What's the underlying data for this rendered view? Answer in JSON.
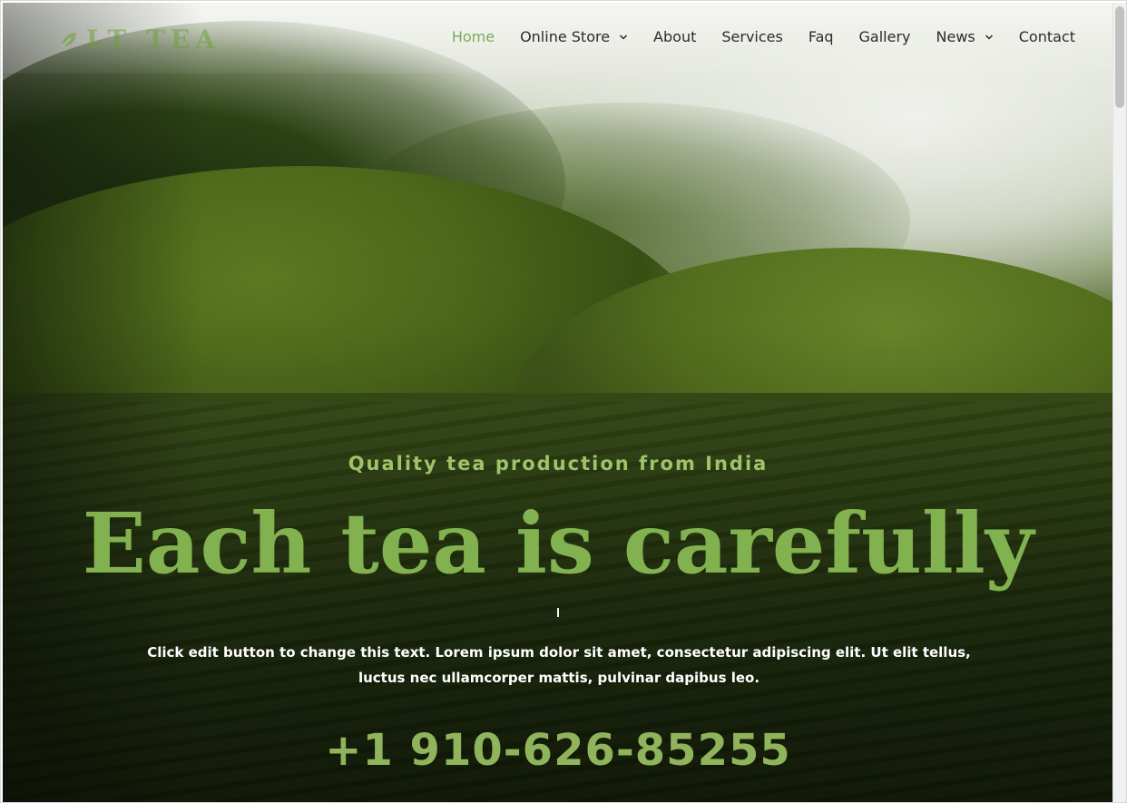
{
  "brand": {
    "logo_text": "LT TEA",
    "accent_color": "#82b24f",
    "active_nav_color": "#7ea95a"
  },
  "nav": {
    "items": [
      {
        "label": "Home",
        "active": true
      },
      {
        "label": "Online Store",
        "dropdown": true
      },
      {
        "label": "About"
      },
      {
        "label": "Services"
      },
      {
        "label": "Faq"
      },
      {
        "label": "Gallery"
      },
      {
        "label": "News",
        "dropdown": true
      },
      {
        "label": "Contact"
      }
    ]
  },
  "hero": {
    "tagline": "Quality tea production from India",
    "headline": "Each tea is carefully",
    "body": "Click edit button to change this text. Lorem ipsum dolor sit amet, consectetur adipiscing elit. Ut elit tellus, luctus nec ullamcorper mattis, pulvinar dapibus leo.",
    "phone": "+1 910-626-85255"
  },
  "icons": {
    "logo": "leaf-icon",
    "dropdown": "chevron-down-icon"
  }
}
